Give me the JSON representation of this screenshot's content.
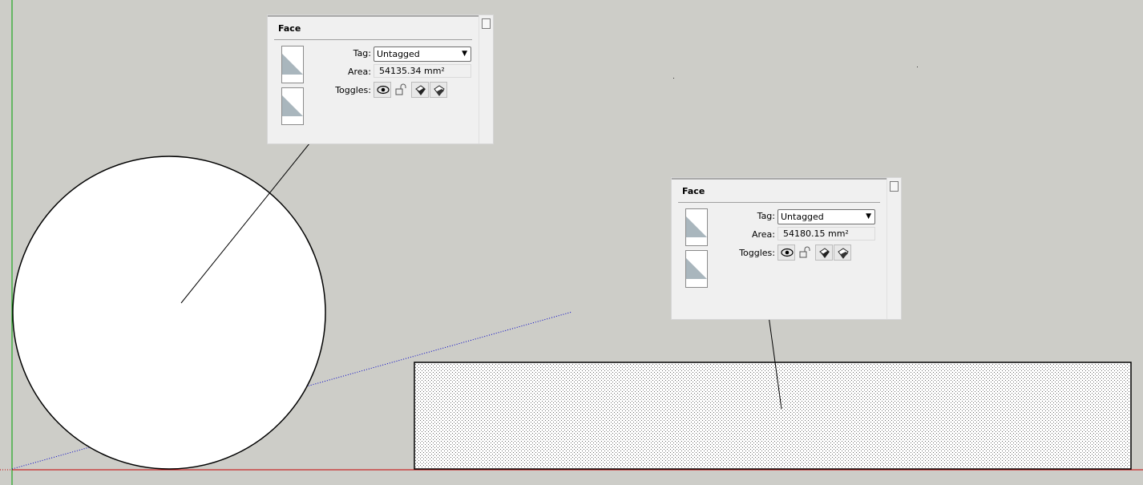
{
  "panels": [
    {
      "title": "Face",
      "tag_label": "Tag:",
      "tag_value": "Untagged",
      "area_label": "Area:",
      "area_value": "54135.34 mm²",
      "toggles_label": "Toggles:",
      "toggles": [
        "visible-eye-icon",
        "lock-icon",
        "cast-shadows-icon",
        "receive-shadows-icon"
      ]
    },
    {
      "title": "Face",
      "tag_label": "Tag:",
      "tag_value": "Untagged",
      "area_label": "Area:",
      "area_value": "54180.15 mm²",
      "toggles_label": "Toggles:",
      "toggles": [
        "visible-eye-icon",
        "lock-icon",
        "cast-shadows-icon",
        "receive-shadows-icon"
      ]
    }
  ],
  "colors": {
    "background": "#cdcdc8",
    "red_axis": "#c80000",
    "green_axis": "#00a000",
    "blue_axis": "#0000c8",
    "swatch_back": "#a9b6bd"
  }
}
